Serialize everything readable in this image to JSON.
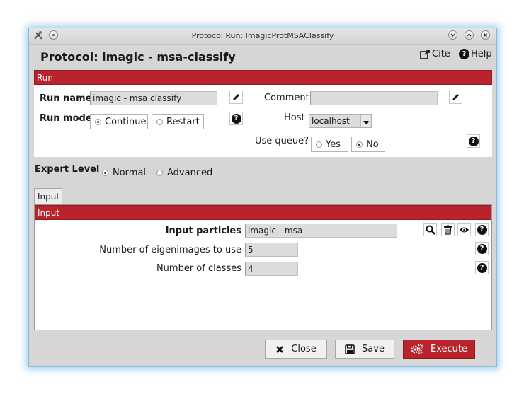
{
  "window": {
    "title": "Protocol Run: ImagicProtMSAClassify"
  },
  "header": {
    "protocol_title": "Protocol: imagic - msa-classify",
    "cite_label": "Cite",
    "help_label": "Help"
  },
  "run_section": {
    "title": "Run",
    "run_name_label": "Run name",
    "run_name_value": "imagic - msa classify",
    "comment_label": "Comment",
    "comment_value": "",
    "run_mode_label": "Run mode",
    "run_mode_options": [
      "Continue",
      "Restart"
    ],
    "run_mode_selected": "Continue",
    "host_label": "Host",
    "host_value": "localhost",
    "use_queue_label": "Use queue?",
    "use_queue_options": [
      "Yes",
      "No"
    ],
    "use_queue_selected": "No"
  },
  "expert_level": {
    "label": "Expert Level",
    "options": [
      "Normal",
      "Advanced"
    ],
    "selected": "Normal"
  },
  "tabs": [
    {
      "label": "Input",
      "active": true
    }
  ],
  "input_section": {
    "title": "Input",
    "input_particles_label": "Input particles",
    "input_particles_value": "imagic - msa",
    "eigenimages_label": "Number of eigenimages to use",
    "eigenimages_value": "5",
    "classes_label": "Number of classes",
    "classes_value": "4"
  },
  "footer": {
    "close_label": "Close",
    "save_label": "Save",
    "execute_label": "Execute"
  },
  "colors": {
    "accent_red": "#b8232c",
    "window_bg": "#d6d6d6",
    "glow": "#50aae6"
  },
  "icons": {
    "edit": "pencil-icon",
    "help": "question-circle-icon",
    "search": "search-icon",
    "delete": "trash-icon",
    "view": "eye-icon",
    "close": "x-icon",
    "save": "floppy-icon",
    "execute": "gears-icon",
    "cite": "external-link-icon"
  }
}
